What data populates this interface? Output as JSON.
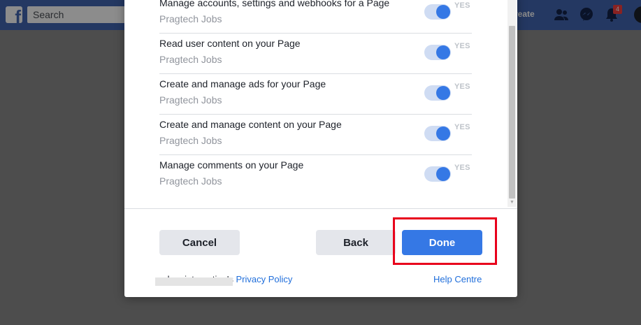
{
  "topbar": {
    "search_placeholder": "Search",
    "create_label": "reate",
    "notification_count": "4",
    "brand_color": "#4267b2"
  },
  "dialog": {
    "permissions": [
      {
        "title": "Manage accounts, settings and webhooks for a Page",
        "page": "Pragtech Jobs",
        "toggle_label": "YES",
        "enabled": true
      },
      {
        "title": "Read user content on your Page",
        "page": "Pragtech Jobs",
        "toggle_label": "YES",
        "enabled": true
      },
      {
        "title": "Create and manage ads for your Page",
        "page": "Pragtech Jobs",
        "toggle_label": "YES",
        "enabled": true
      },
      {
        "title": "Create and manage content on your Page",
        "page": "Pragtech Jobs",
        "toggle_label": "YES",
        "enabled": true
      },
      {
        "title": "Manage comments on your Page",
        "page": "Pragtech Jobs",
        "toggle_label": "YES",
        "enabled": true
      }
    ],
    "buttons": {
      "cancel": "Cancel",
      "back": "Back",
      "done": "Done"
    },
    "footer": {
      "app_name": "odoo_integration's",
      "privacy_policy": "Privacy Policy",
      "help_centre": "Help Centre"
    },
    "accent_color": "#3578e5",
    "highlight_color": "#e8001c"
  }
}
